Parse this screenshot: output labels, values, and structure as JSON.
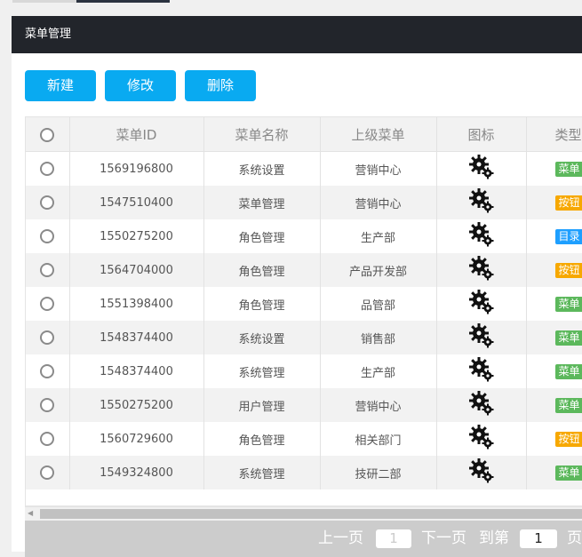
{
  "panel": {
    "title": "菜单管理"
  },
  "toolbar": {
    "new_label": "新建",
    "edit_label": "修改",
    "delete_label": "删除"
  },
  "columns": [
    "菜单ID",
    "菜单名称",
    "上级菜单",
    "图标",
    "类型"
  ],
  "rows": [
    {
      "id": "1569196800",
      "name": "系统设置",
      "parent": "营销中心",
      "icon": "gears-icon",
      "type": "菜单",
      "type_color": "#5cb85c"
    },
    {
      "id": "1547510400",
      "name": "菜单管理",
      "parent": "营销中心",
      "icon": "gears-icon",
      "type": "按钮",
      "type_color": "#f7a800"
    },
    {
      "id": "1550275200",
      "name": "角色管理",
      "parent": "生产部",
      "icon": "gears-icon",
      "type": "目录",
      "type_color": "#1e9fff"
    },
    {
      "id": "1564704000",
      "name": "角色管理",
      "parent": "产品开发部",
      "icon": "gears-icon",
      "type": "按钮",
      "type_color": "#f7a800"
    },
    {
      "id": "1551398400",
      "name": "角色管理",
      "parent": "品管部",
      "icon": "gears-icon",
      "type": "菜单",
      "type_color": "#5cb85c"
    },
    {
      "id": "1548374400",
      "name": "系统设置",
      "parent": "销售部",
      "icon": "gears-icon",
      "type": "菜单",
      "type_color": "#5cb85c"
    },
    {
      "id": "1548374400",
      "name": "系统管理",
      "parent": "生产部",
      "icon": "gears-icon",
      "type": "菜单",
      "type_color": "#5cb85c"
    },
    {
      "id": "1550275200",
      "name": "用户管理",
      "parent": "营销中心",
      "icon": "gears-icon",
      "type": "菜单",
      "type_color": "#5cb85c"
    },
    {
      "id": "1560729600",
      "name": "角色管理",
      "parent": "相关部门",
      "icon": "gears-icon",
      "type": "按钮",
      "type_color": "#f7a800"
    },
    {
      "id": "1549324800",
      "name": "系统管理",
      "parent": "技研二部",
      "icon": "gears-icon",
      "type": "菜单",
      "type_color": "#5cb85c"
    }
  ],
  "pager": {
    "prev_label": "上一页",
    "current_page": "1",
    "next_label": "下一页",
    "goto_label": "到第",
    "goto_value": "1",
    "unit_label": "页"
  }
}
